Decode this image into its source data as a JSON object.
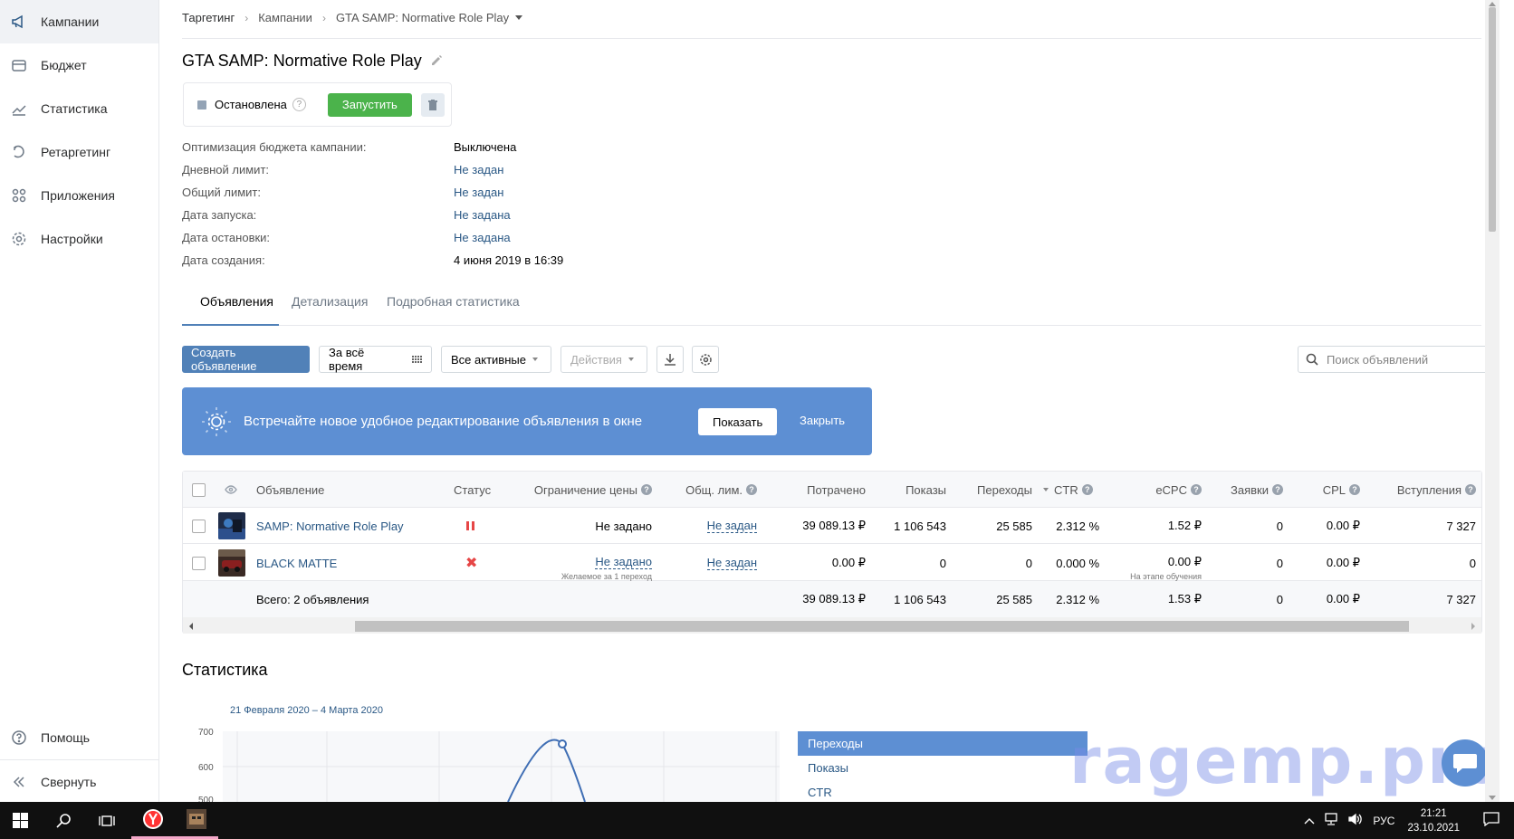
{
  "sidebar": {
    "items": [
      {
        "label": "Кампании",
        "icon": "megaphone-icon"
      },
      {
        "label": "Бюджет",
        "icon": "wallet-icon"
      },
      {
        "label": "Статистика",
        "icon": "chart-line-icon"
      },
      {
        "label": "Ретаргетинг",
        "icon": "retarget-icon"
      },
      {
        "label": "Приложения",
        "icon": "apps-grid-icon"
      },
      {
        "label": "Настройки",
        "icon": "gear-icon"
      }
    ],
    "help": "Помощь",
    "collapse": "Свернуть"
  },
  "breadcrumb": {
    "root": "Таргетинг",
    "campaigns": "Кампании",
    "current": "GTA SAMP: Normative Role Play"
  },
  "campaign": {
    "title": "GTA SAMP: Normative Role Play",
    "status": "Остановлена",
    "run_label": "Запустить"
  },
  "props": [
    {
      "key": "Оптимизация бюджета кампании:",
      "value": "Выключена"
    },
    {
      "key": "Дневной лимит:",
      "value": "Не задан"
    },
    {
      "key": "Общий лимит:",
      "value": "Не задан"
    },
    {
      "key": "Дата запуска:",
      "value": "Не задана"
    },
    {
      "key": "Дата остановки:",
      "value": "Не задана"
    },
    {
      "key": "Дата создания:",
      "value": "4 июня 2019 в 16:39"
    }
  ],
  "tabs": [
    "Объявления",
    "Детализация",
    "Подробная статистика"
  ],
  "toolbar": {
    "create": "Создать объявление",
    "period": "За всё время",
    "filter": "Все активные",
    "actions": "Действия",
    "search_placeholder": "Поиск объявлений"
  },
  "banner": {
    "text": "Встречайте новое удобное редактирование объявления в окне",
    "show": "Показать",
    "close": "Закрыть"
  },
  "table": {
    "headers": {
      "ad": "Объявление",
      "status": "Статус",
      "price_limit": "Ограничение цены",
      "total_limit": "Общ. лим.",
      "spent": "Потрачено",
      "impressions": "Показы",
      "clicks": "Переходы",
      "ctr": "CTR",
      "ecpc": "eCPC",
      "leads": "Заявки",
      "cpl": "CPL",
      "joins": "Вступления"
    },
    "rows": [
      {
        "name": "SAMP: Normative Role Play",
        "status": "paused",
        "price_limit": "Не задано",
        "price_sub": "",
        "total_limit": "Не задан",
        "spent": "39 089.13 ₽",
        "impressions": "1 106 543",
        "clicks": "25 585",
        "ctr": "2.312 %",
        "ecpc": "1.52 ₽",
        "ecpc_sub": "",
        "leads": "0",
        "cpl": "0.00 ₽",
        "joins": "7 327"
      },
      {
        "name": "BLACK MATTE",
        "status": "rejected",
        "price_limit": "Не задано",
        "price_sub": "Желаемое за 1 переход",
        "total_limit": "Не задан",
        "spent": "0.00 ₽",
        "impressions": "0",
        "clicks": "0",
        "ctr": "0.000 %",
        "ecpc": "0.00 ₽",
        "ecpc_sub": "На этапе обучения",
        "leads": "0",
        "cpl": "0.00 ₽",
        "joins": "0"
      }
    ],
    "total": {
      "label": "Всего: 2 объявления",
      "spent": "39 089.13 ₽",
      "impressions": "1 106 543",
      "clicks": "25 585",
      "ctr": "2.312 %",
      "ecpc": "1.53 ₽",
      "leads": "0",
      "cpl": "0.00 ₽",
      "joins": "7 327"
    }
  },
  "stats": {
    "title": "Статистика",
    "date_range": "21 Февраля 2020 – 4 Марта 2020",
    "y_ticks": [
      "700",
      "600",
      "500"
    ],
    "metrics": [
      "Переходы",
      "Показы",
      "CTR"
    ]
  },
  "watermark": "ragemp.pro",
  "taskbar": {
    "lang": "РУС",
    "time": "21:21",
    "date": "23.10.2021"
  }
}
